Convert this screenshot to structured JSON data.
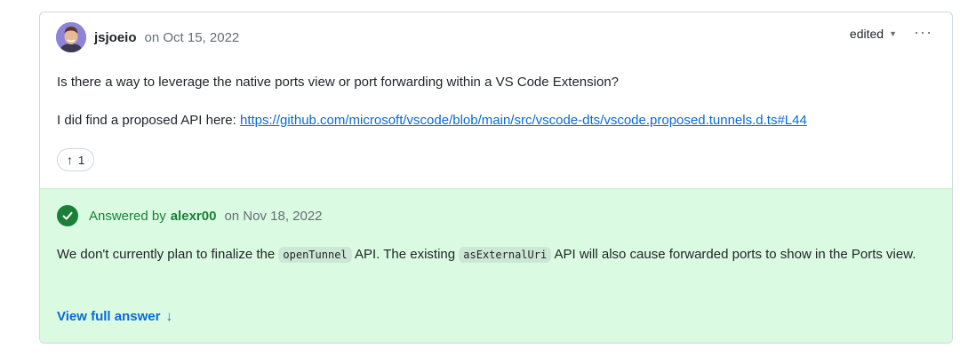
{
  "post": {
    "author": "jsjoeio",
    "date": "on Oct 15, 2022",
    "edited_label": "edited",
    "edited_caret": "▼",
    "more_label": "···",
    "question": "Is there a way to leverage the native ports view or port forwarding within a VS Code Extension?",
    "proposed_prefix": "I did find a proposed API here: ",
    "proposed_link": "https://github.com/microsoft/vscode/blob/main/src/vscode-dts/vscode.proposed.tunnels.d.ts#L44",
    "upvote_arrow": "↑",
    "upvote_count": "1"
  },
  "answer": {
    "answered_by_label": "Answered by",
    "answerer": "alexr00",
    "date": "on Nov 18, 2022",
    "body_part1": "We don't currently plan to finalize the ",
    "code1": "openTunnel",
    "body_part2": " API. The existing ",
    "code2": "asExternalUri",
    "body_part3": " API will also cause forwarded ports to show in the Ports view.",
    "view_full_label": "View full answer",
    "view_full_arrow": "↓"
  },
  "colors": {
    "answer_bg": "#dafbe1",
    "success": "#1a7f37",
    "link": "#0969da",
    "muted": "#656d76",
    "border": "#d0d7de"
  }
}
